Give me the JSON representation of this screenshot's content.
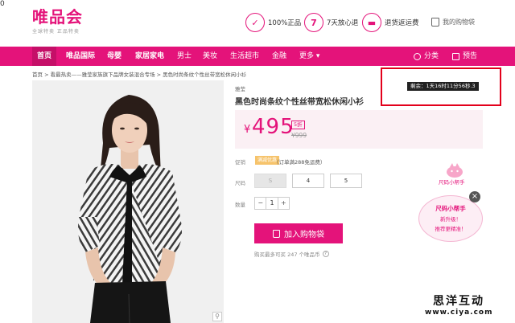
{
  "header": {
    "logo": "唯品会",
    "logo_sub": "全球特卖 正品特卖",
    "promises": [
      {
        "label": "100%正品",
        "icon": "shield-icon",
        "glyph": "✓"
      },
      {
        "label": "7天放心退",
        "icon": "seven-day-return-icon",
        "glyph": "7"
      },
      {
        "label": "退货返运费",
        "icon": "shipping-refund-icon",
        "glyph": "▬"
      }
    ],
    "cart_label": "我的购物袋",
    "cart_count": "0"
  },
  "nav": {
    "items": [
      "首页",
      "唯品国际",
      "母婴",
      "家居家电",
      "男士",
      "美妆",
      "生活超市",
      "金融",
      "更多"
    ],
    "more_chevron": "▾",
    "category_label": "分类",
    "preview_label": "预告"
  },
  "breadcrumb": "首页 > 看最热卖——雅莹家族旗下品牌女装混合专场 > 黑色时尚条纹个性丝带宽松休闲小衫",
  "product": {
    "brand": "雅莹",
    "title": "黑色时尚条纹个性丝带宽松休闲小衫",
    "countdown": "剩余：1天16时11分56秒.3",
    "currency": "¥",
    "price": "495",
    "discount": "5折",
    "original_price": "¥999",
    "promo_label": "促销",
    "promo_tag": "满减优惠",
    "promo_text": "（订单满288免运费）",
    "size_label": "尺码",
    "sizes": [
      {
        "label": "S",
        "disabled": true
      },
      {
        "label": "4",
        "disabled": false
      },
      {
        "label": "5",
        "disabled": false
      }
    ],
    "qty_label": "数量",
    "qty_minus": "−",
    "qty_value": "1",
    "qty_plus": "+",
    "add_to_cart": "加入购物袋",
    "bought_text": "购买最多可买 247 个唯品币"
  },
  "helper": {
    "label": "尺码小帮手",
    "title": "尺码小帮手",
    "line1": "新升级！",
    "line2": "推荐更精准！",
    "close": "×"
  },
  "watermark": {
    "name": "思洋互动",
    "url": "www.ciya.com"
  },
  "colors": {
    "brand": "#e4137a",
    "highlight_frame": "#e3001b"
  }
}
